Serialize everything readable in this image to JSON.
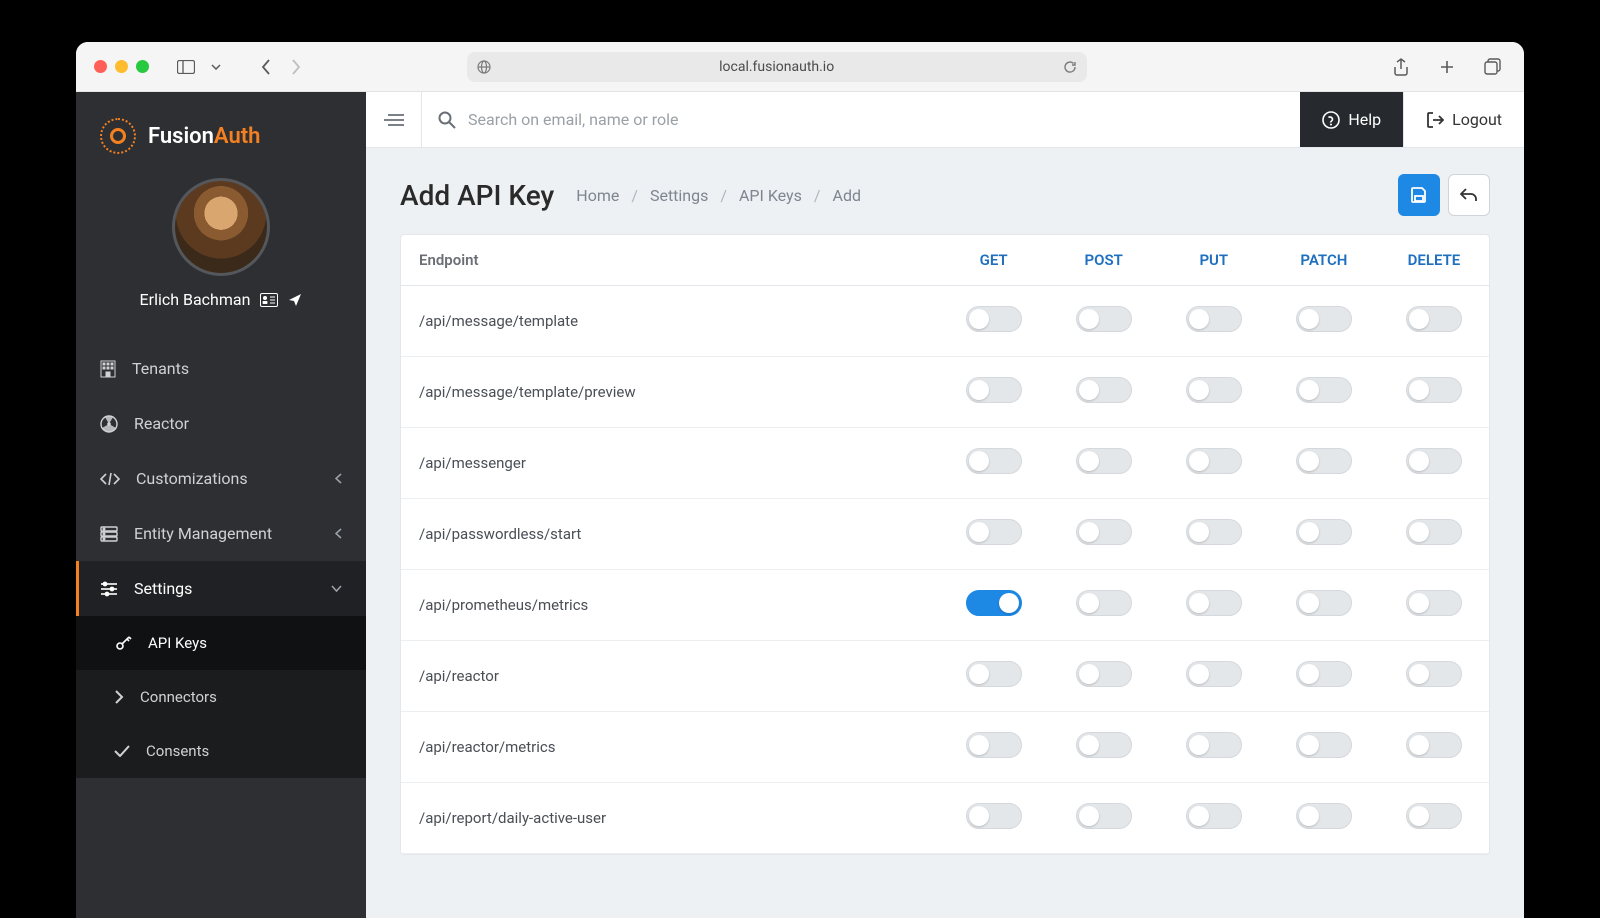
{
  "browser": {
    "url": "local.fusionauth.io"
  },
  "brand": {
    "name_a": "Fusion",
    "name_b": "Auth"
  },
  "user": {
    "display_name": "Erlich Bachman"
  },
  "sidebar": {
    "items": [
      {
        "label": "Tenants",
        "icon": "building-icon"
      },
      {
        "label": "Reactor",
        "icon": "radiation-icon"
      },
      {
        "label": "Customizations",
        "icon": "code-icon",
        "expandable": true
      },
      {
        "label": "Entity Management",
        "icon": "server-icon",
        "expandable": true
      },
      {
        "label": "Settings",
        "icon": "sliders-icon",
        "expandable": true,
        "active": true,
        "children": [
          {
            "label": "API Keys",
            "icon": "key-icon",
            "selected": true
          },
          {
            "label": "Connectors",
            "icon": "chevron-right-icon"
          },
          {
            "label": "Consents",
            "icon": "check-icon"
          }
        ]
      }
    ]
  },
  "topbar": {
    "search_placeholder": "Search on email, name or role",
    "help_label": "Help",
    "logout_label": "Logout"
  },
  "page": {
    "title": "Add API Key",
    "breadcrumbs": [
      "Home",
      "Settings",
      "API Keys",
      "Add"
    ]
  },
  "table": {
    "headers": {
      "endpoint": "Endpoint",
      "methods": [
        "GET",
        "POST",
        "PUT",
        "PATCH",
        "DELETE"
      ]
    },
    "rows": [
      {
        "endpoint": "/api/message/template",
        "toggles": [
          false,
          false,
          false,
          false,
          false
        ]
      },
      {
        "endpoint": "/api/message/template/preview",
        "toggles": [
          false,
          false,
          false,
          false,
          false
        ]
      },
      {
        "endpoint": "/api/messenger",
        "toggles": [
          false,
          false,
          false,
          false,
          false
        ]
      },
      {
        "endpoint": "/api/passwordless/start",
        "toggles": [
          false,
          false,
          false,
          false,
          false
        ]
      },
      {
        "endpoint": "/api/prometheus/metrics",
        "toggles": [
          true,
          false,
          false,
          false,
          false
        ]
      },
      {
        "endpoint": "/api/reactor",
        "toggles": [
          false,
          false,
          false,
          false,
          false
        ]
      },
      {
        "endpoint": "/api/reactor/metrics",
        "toggles": [
          false,
          false,
          false,
          false,
          false
        ]
      },
      {
        "endpoint": "/api/report/daily-active-user",
        "toggles": [
          false,
          false,
          false,
          false,
          false
        ]
      }
    ]
  }
}
